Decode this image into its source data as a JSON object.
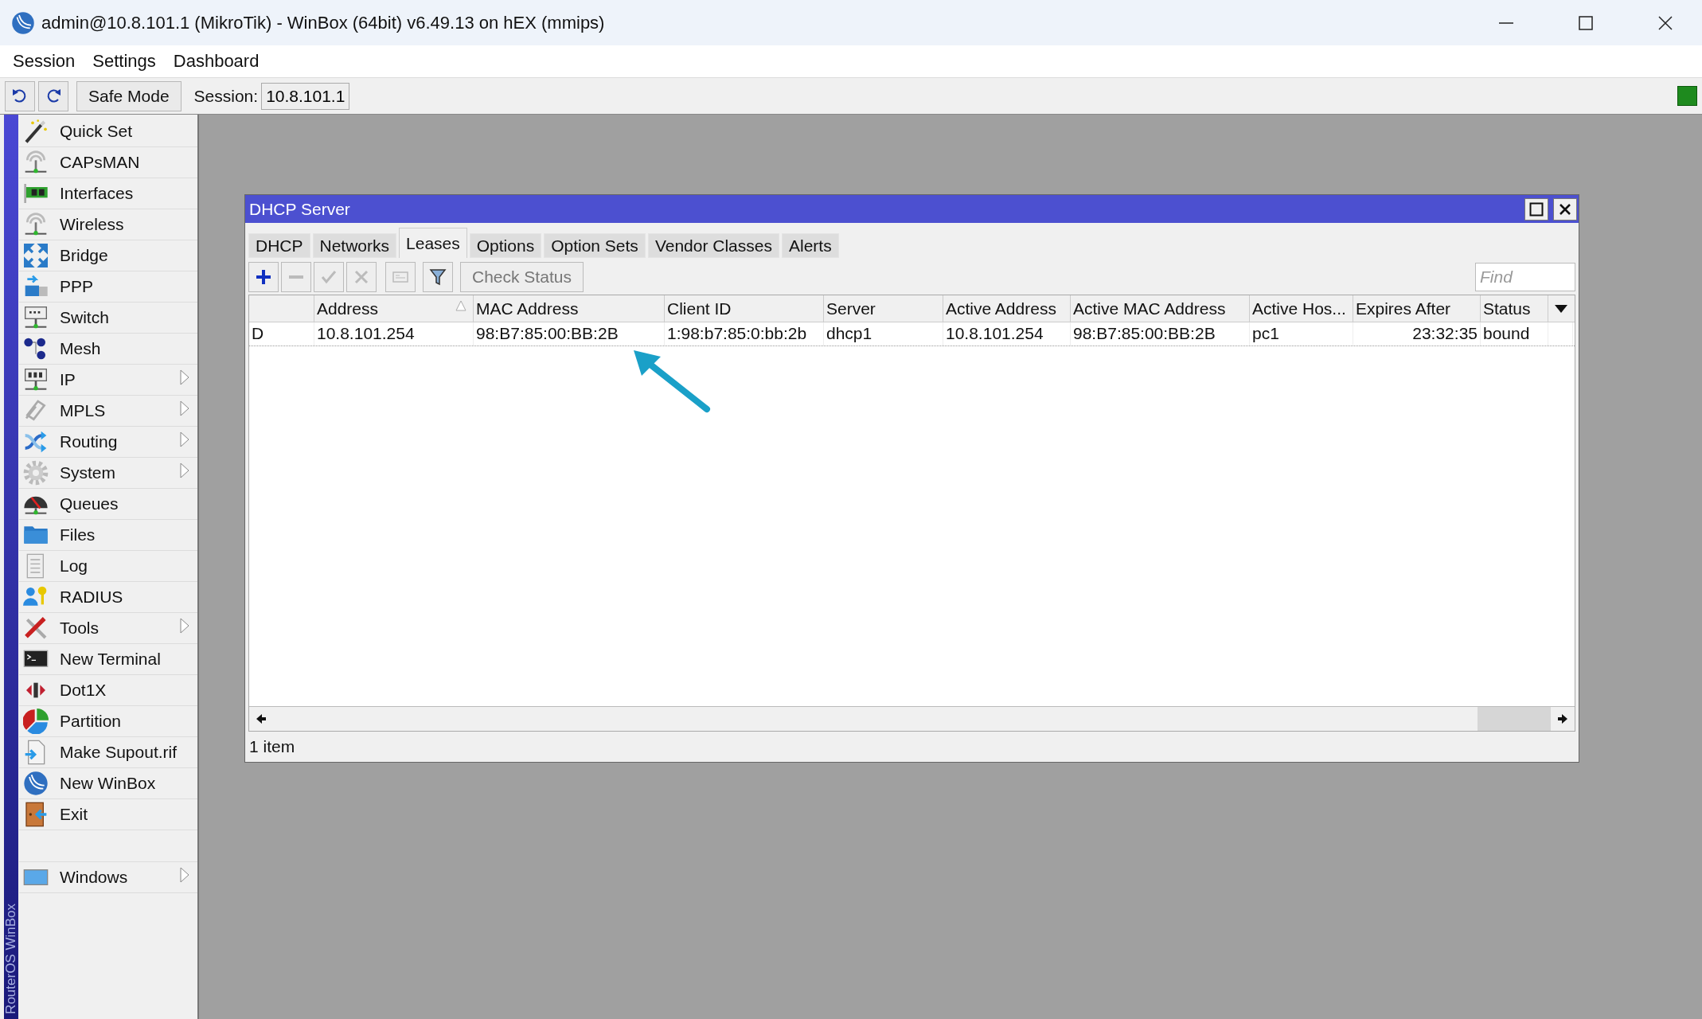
{
  "window": {
    "title": "admin@10.8.101.1 (MikroTik) - WinBox (64bit) v6.49.13 on hEX (mmips)"
  },
  "menu": [
    "Session",
    "Settings",
    "Dashboard"
  ],
  "toolbar": {
    "safe_mode": "Safe Mode",
    "session_label": "Session:",
    "session_value": "10.8.101.1",
    "connected": true
  },
  "sidebar": {
    "brand": "RouterOS WinBox",
    "items": [
      {
        "label": "Quick Set",
        "submenu": false
      },
      {
        "label": "CAPsMAN",
        "submenu": false
      },
      {
        "label": "Interfaces",
        "submenu": false
      },
      {
        "label": "Wireless",
        "submenu": false
      },
      {
        "label": "Bridge",
        "submenu": false
      },
      {
        "label": "PPP",
        "submenu": false
      },
      {
        "label": "Switch",
        "submenu": false
      },
      {
        "label": "Mesh",
        "submenu": false
      },
      {
        "label": "IP",
        "submenu": true
      },
      {
        "label": "MPLS",
        "submenu": true
      },
      {
        "label": "Routing",
        "submenu": true
      },
      {
        "label": "System",
        "submenu": true
      },
      {
        "label": "Queues",
        "submenu": false
      },
      {
        "label": "Files",
        "submenu": false
      },
      {
        "label": "Log",
        "submenu": false
      },
      {
        "label": "RADIUS",
        "submenu": false
      },
      {
        "label": "Tools",
        "submenu": true
      },
      {
        "label": "New Terminal",
        "submenu": false
      },
      {
        "label": "Dot1X",
        "submenu": false
      },
      {
        "label": "Partition",
        "submenu": false
      },
      {
        "label": "Make Supout.rif",
        "submenu": false
      },
      {
        "label": "New WinBox",
        "submenu": false
      },
      {
        "label": "Exit",
        "submenu": false
      }
    ],
    "bottom_items": [
      {
        "label": "Windows",
        "submenu": true
      }
    ]
  },
  "dhcp_window": {
    "title": "DHCP Server",
    "tabs": [
      {
        "label": "DHCP",
        "selected": false
      },
      {
        "label": "Networks",
        "selected": false
      },
      {
        "label": "Leases",
        "selected": true
      },
      {
        "label": "Options",
        "selected": false
      },
      {
        "label": "Option Sets",
        "selected": false
      },
      {
        "label": "Vendor Classes",
        "selected": false
      },
      {
        "label": "Alerts",
        "selected": false
      }
    ],
    "toolbar": [
      {
        "kind": "add",
        "disabled": false
      },
      {
        "kind": "remove",
        "disabled": true
      },
      {
        "kind": "enable",
        "disabled": true
      },
      {
        "kind": "disable",
        "disabled": true
      },
      {
        "kind": "comment",
        "disabled": true
      },
      {
        "kind": "filter",
        "disabled": false
      }
    ],
    "check_status": {
      "label": "Check Status",
      "disabled": true
    },
    "find": {
      "placeholder": "Find"
    },
    "table": {
      "columns": [
        {
          "label": "Address",
          "sorted": true
        },
        {
          "label": "MAC Address",
          "sorted": false
        },
        {
          "label": "Client ID",
          "sorted": false
        },
        {
          "label": "Server",
          "sorted": false
        },
        {
          "label": "Active Address",
          "sorted": false
        },
        {
          "label": "Active MAC Address",
          "sorted": false
        },
        {
          "label": "Active Hos...",
          "sorted": false
        },
        {
          "label": "Expires After",
          "sorted": false
        },
        {
          "label": "Status",
          "sorted": false
        }
      ],
      "rows": [
        {
          "flag": "D",
          "cells": [
            "10.8.101.254",
            "98:B7:85:00:BB:2B",
            "1:98:b7:85:0:bb:2b",
            "dhcp1",
            "10.8.101.254",
            "98:B7:85:00:BB:2B",
            "pc1",
            "23:32:35",
            "bound"
          ]
        }
      ]
    },
    "status": "1 item"
  }
}
